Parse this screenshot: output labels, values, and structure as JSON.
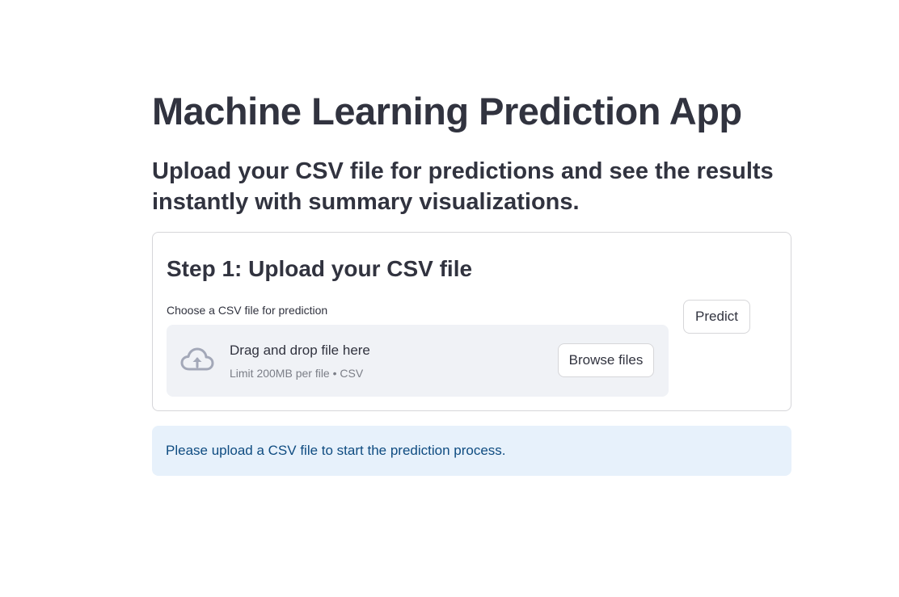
{
  "app": {
    "title": "Machine Learning Prediction App",
    "subtitle": "Upload your CSV file for predictions and see the results instantly with summary visualizations."
  },
  "step1": {
    "title": "Step 1: Upload your CSV file",
    "uploader": {
      "label": "Choose a CSV file for prediction",
      "drop_text": "Drag and drop file here",
      "limit_text": "Limit 200MB per file • CSV",
      "browse_label": "Browse files",
      "icon": "cloud-upload-icon"
    },
    "predict_label": "Predict"
  },
  "info": {
    "message": "Please upload a CSV file to start the prediction process."
  },
  "colors": {
    "text": "#31333f",
    "muted": "#7b7e87",
    "dropzone_bg": "#f0f2f6",
    "info_bg": "#e7f1fb",
    "info_text": "#0f4c81",
    "border": "#d6d6d9",
    "icon": "#a3a8b8"
  }
}
